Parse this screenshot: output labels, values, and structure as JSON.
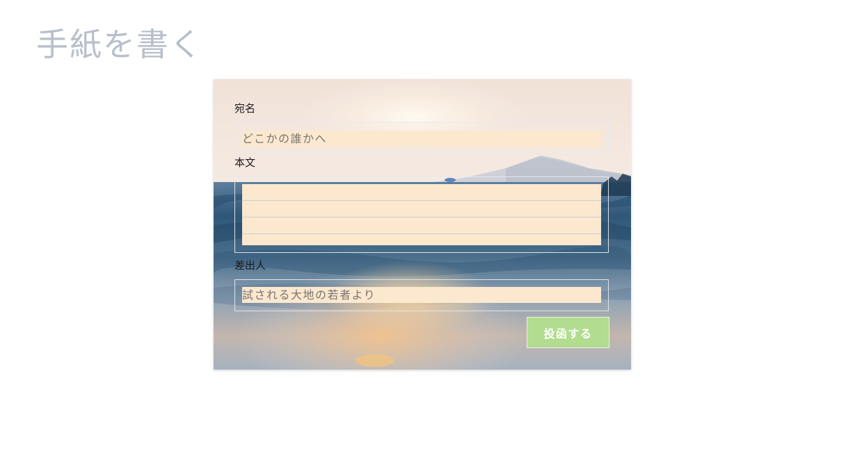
{
  "page": {
    "title": "手紙を書く"
  },
  "form": {
    "recipient": {
      "label": "宛名",
      "placeholder": "どこかの誰かへ",
      "value": ""
    },
    "body": {
      "label": "本文",
      "value": ""
    },
    "sender": {
      "label": "差出人",
      "placeholder": "試される大地の若者より",
      "value": ""
    },
    "submit_label": "投函する"
  },
  "colors": {
    "title": "#b7bfcb",
    "field_fill": "#fbe8cf",
    "submit_button": "#b2dc8f"
  }
}
